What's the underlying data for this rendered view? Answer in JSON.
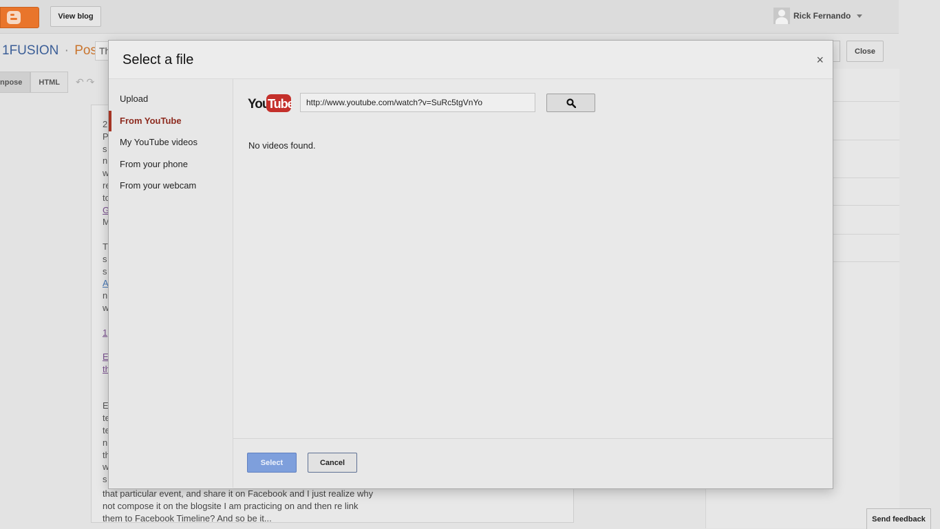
{
  "topbar": {
    "logo_icon": "blogger-logo-icon",
    "view_blog_label": "View blog",
    "user_name": "Rick Fernando"
  },
  "editor_header": {
    "blog_name": "1FUSION",
    "separator": "·",
    "post_label": "Post",
    "title_stub": "Th",
    "close_label": "Close",
    "compose_tab": "npose",
    "html_tab": "HTML"
  },
  "editor": {
    "line_fragments": [
      "2",
      "P",
      "s",
      "n",
      "w",
      "re",
      "to",
      "G",
      "M",
      "",
      "T",
      "s",
      "s",
      "A",
      "n",
      "w",
      "",
      "1",
      "",
      "E",
      "th",
      "",
      "",
      "E",
      "te",
      "te",
      "n",
      "th",
      "w",
      "s"
    ],
    "bottom_lines": [
      "that particular event, and share it on Facebook and I just realize why",
      "not compose it on the blogsite I am practicing on and then re link",
      "them to Facebook Timeline? And so be it..."
    ]
  },
  "dialog": {
    "title": "Select a file",
    "close_symbol": "×",
    "nav_items": [
      {
        "label": "Upload",
        "active": false
      },
      {
        "label": "From YouTube",
        "active": true
      },
      {
        "label": "My YouTube videos",
        "active": false
      },
      {
        "label": "From your phone",
        "active": false
      },
      {
        "label": "From your webcam",
        "active": false
      }
    ],
    "youtube": {
      "logo_text_you": "You",
      "logo_text_tube": "Tube",
      "search_value": "http://www.youtube.com/watch?v=SuRc5tgVnYo",
      "search_icon": "magnifier-icon",
      "no_results": "No videos found."
    },
    "footer": {
      "select_label": "Select",
      "cancel_label": "Cancel"
    }
  },
  "feedback": {
    "label": "Send feedback"
  },
  "colors": {
    "blogger_orange": "#e9752b",
    "active_nav": "#8d2a1e",
    "select_button": "#7e9fdc",
    "youtube_red": "#c4302b"
  }
}
